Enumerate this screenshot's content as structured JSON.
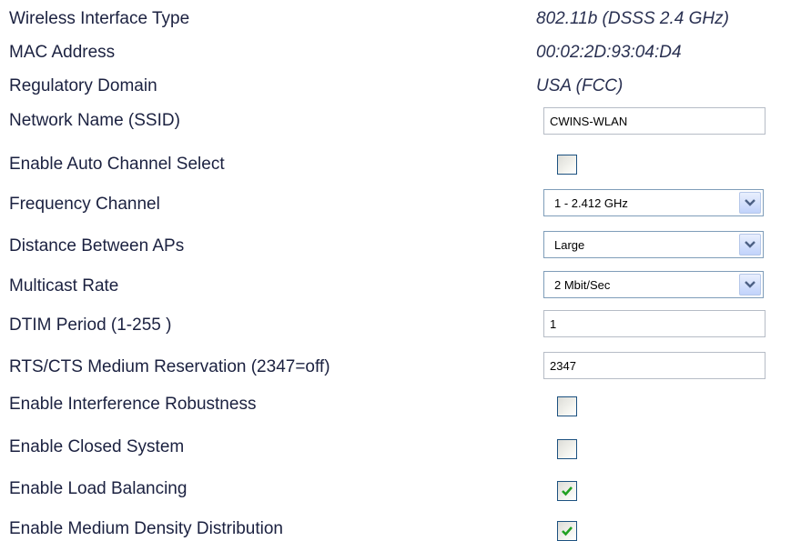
{
  "settings": {
    "wireless_interface_type": {
      "label": "Wireless Interface Type",
      "value": "802.11b (DSSS 2.4 GHz)"
    },
    "mac_address": {
      "label": "MAC Address",
      "value": "00:02:2D:93:04:D4"
    },
    "regulatory_domain": {
      "label": "Regulatory Domain",
      "value": "USA (FCC)"
    },
    "network_name": {
      "label": "Network Name (SSID)",
      "value": "CWINS-WLAN"
    },
    "auto_channel_select": {
      "label": "Enable Auto Channel Select",
      "checked": false
    },
    "frequency_channel": {
      "label": "Frequency Channel",
      "selected": "1 - 2.412 GHz"
    },
    "distance_between_aps": {
      "label": "Distance Between APs",
      "selected": "Large"
    },
    "multicast_rate": {
      "label": "Multicast Rate",
      "selected": "2 Mbit/Sec"
    },
    "dtim_period": {
      "label": "DTIM Period (1-255 )",
      "value": "1"
    },
    "rts_cts": {
      "label": "RTS/CTS Medium Reservation (2347=off)",
      "value": "2347"
    },
    "interference_robustness": {
      "label": "Enable Interference Robustness",
      "checked": false
    },
    "closed_system": {
      "label": "Enable Closed System",
      "checked": false
    },
    "load_balancing": {
      "label": "Enable Load Balancing",
      "checked": true
    },
    "medium_density_distribution": {
      "label": "Enable Medium Density Distribution",
      "checked": true
    }
  },
  "icons": {
    "dropdown": "chevron-down-icon",
    "check": "checkmark-icon"
  },
  "colors": {
    "label_text": "#1b2140",
    "value_text": "#2a3152",
    "checkmark": "#21a121",
    "dropdown_arrow": "#4d6185",
    "checkbox_border": "#1c5180",
    "select_border": "#7f9db9"
  }
}
